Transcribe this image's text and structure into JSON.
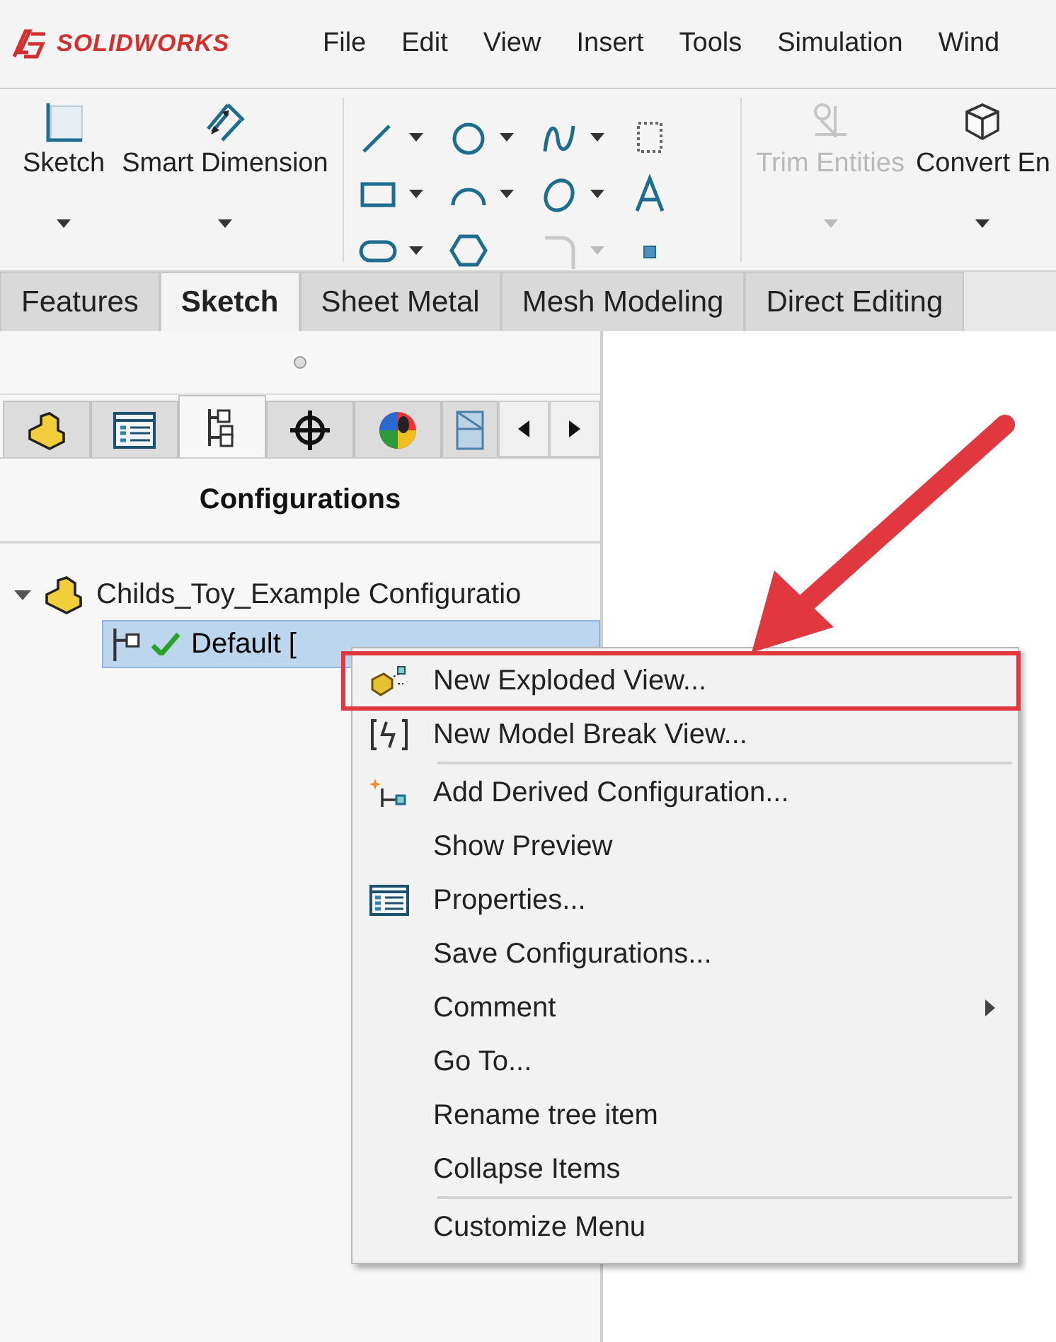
{
  "app": {
    "logo": "SOLIDWORKS"
  },
  "menu_bar": [
    "File",
    "Edit",
    "View",
    "Insert",
    "Tools",
    "Simulation",
    "Wind"
  ],
  "ribbon": {
    "large_buttons": [
      {
        "label": "Sketch",
        "kind": "sketch",
        "disabled": false
      },
      {
        "label": "Smart Dimension",
        "kind": "dimension",
        "disabled": false
      }
    ],
    "side_buttons": [
      {
        "label": "Trim Entities",
        "kind": "trim",
        "disabled": true
      },
      {
        "label": "Convert En",
        "kind": "convert",
        "disabled": false
      }
    ]
  },
  "command_tabs": [
    {
      "label": "Features",
      "selected": false
    },
    {
      "label": "Sketch",
      "selected": true
    },
    {
      "label": "Sheet Metal",
      "selected": false
    },
    {
      "label": "Mesh Modeling",
      "selected": false
    },
    {
      "label": "Direct Editing",
      "selected": false
    }
  ],
  "panel": {
    "tabs": [
      {
        "kind": "part",
        "selected": false
      },
      {
        "kind": "properties",
        "selected": false
      },
      {
        "kind": "config",
        "selected": true
      },
      {
        "kind": "target",
        "selected": false
      },
      {
        "kind": "appearance",
        "selected": false
      },
      {
        "kind": "display",
        "selected": false
      }
    ],
    "title": "Configurations",
    "tree": [
      {
        "label": "Childs_Toy_Example Configuratio",
        "expanded": true,
        "selected": false,
        "children": [
          {
            "label": "Default [",
            "active": true,
            "selected": true
          }
        ]
      }
    ]
  },
  "context_menu": [
    {
      "label": "New Exploded View...",
      "kind": "exploded",
      "highlighted": true,
      "submenu": false,
      "separator_after": false
    },
    {
      "label": "New Model Break View...",
      "kind": "break",
      "highlighted": false,
      "submenu": false,
      "separator_after": true
    },
    {
      "label": "Add Derived Configuration...",
      "kind": "derived",
      "highlighted": false,
      "submenu": false,
      "separator_after": false
    },
    {
      "label": "Show Preview",
      "kind": "plain",
      "highlighted": false,
      "submenu": false,
      "separator_after": false
    },
    {
      "label": "Properties...",
      "kind": "properties",
      "highlighted": false,
      "submenu": false,
      "separator_after": false
    },
    {
      "label": "Save Configurations...",
      "kind": "plain",
      "highlighted": false,
      "submenu": false,
      "separator_after": false
    },
    {
      "label": "Comment",
      "kind": "plain",
      "highlighted": false,
      "submenu": true,
      "separator_after": false
    },
    {
      "label": "Go To...",
      "kind": "plain",
      "highlighted": false,
      "submenu": false,
      "separator_after": false
    },
    {
      "label": "Rename tree item",
      "kind": "plain",
      "highlighted": false,
      "submenu": false,
      "separator_after": false
    },
    {
      "label": "Collapse Items",
      "kind": "plain",
      "highlighted": false,
      "submenu": false,
      "separator_after": true
    },
    {
      "label": "Customize Menu",
      "kind": "plain",
      "highlighted": false,
      "submenu": false,
      "separator_after": false
    }
  ]
}
